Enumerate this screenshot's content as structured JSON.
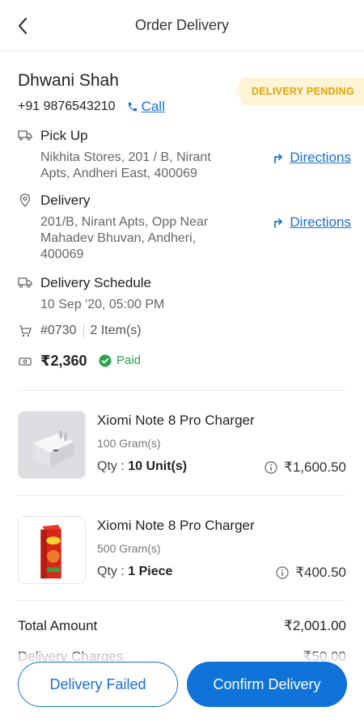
{
  "header": {
    "title": "Order Delivery"
  },
  "customer": {
    "name": "Dhwani Shah",
    "phone": "+91 9876543210",
    "call_label": "Call"
  },
  "status_badge": "DELIVERY PENDING",
  "pickup": {
    "label": "Pick Up",
    "address_line1": "Nikhita Stores, 201 / B, Nirant",
    "address_line2": "Apts, Andheri East, 400069",
    "directions_label": "Directions"
  },
  "delivery": {
    "label": "Delivery",
    "address_line1": "201/B, Nirant Apts, Opp Near",
    "address_line2": "Mahadev Bhuvan, Andheri,",
    "address_line3": "400069",
    "directions_label": "Directions"
  },
  "schedule": {
    "label": "Delivery Schedule",
    "value": "10 Sep '20, 05:00 PM"
  },
  "order": {
    "id": "#0730",
    "items": "2 Item(s)"
  },
  "payment": {
    "amount": "₹2,360",
    "status": "Paid"
  },
  "items": [
    {
      "name": "Xiomi Note 8 Pro Charger",
      "weight": "100 Gram(s)",
      "qty_label": "Qty :",
      "qty_value": "10 Unit(s)",
      "price": "₹1,600.50"
    },
    {
      "name": "Xiomi Note 8 Pro Charger",
      "weight": "500 Gram(s)",
      "qty_label": "Qty :",
      "qty_value": "1 Piece",
      "price": "₹400.50"
    }
  ],
  "summary": {
    "total_label": "Total Amount",
    "total_value": "₹2,001.00",
    "delivery_label": "Delivery Charges",
    "delivery_value": "₹50.00"
  },
  "buttons": {
    "failed": "Delivery Failed",
    "confirm": "Confirm Delivery"
  },
  "colors": {
    "accent": "#1a6fd6",
    "primary_button": "#0f73d9",
    "badge_bg": "#fff4d6",
    "badge_text": "#e1a206",
    "paid": "#2aa34a"
  }
}
